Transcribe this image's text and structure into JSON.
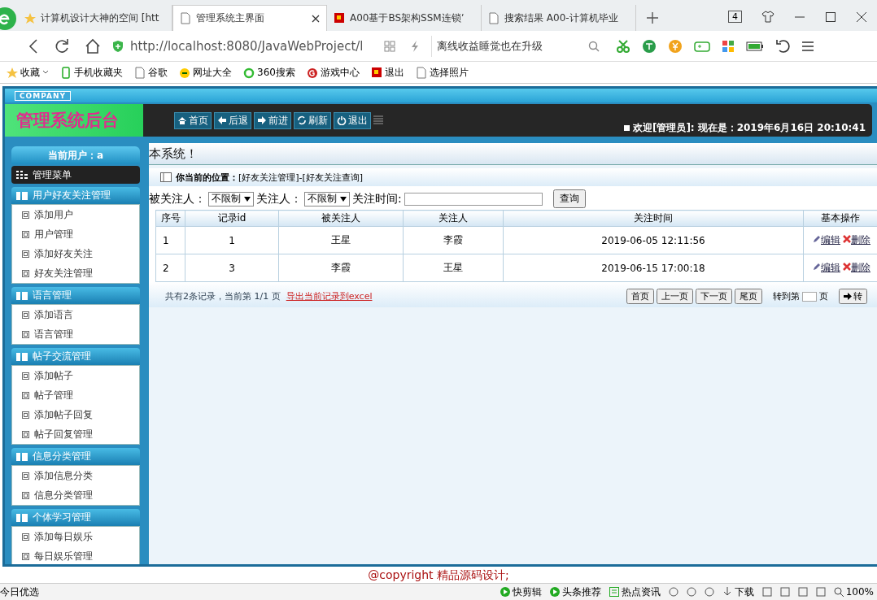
{
  "browser": {
    "tabs": [
      {
        "title": "计算机设计大神的空间 [htt",
        "selected": false,
        "kind": "star"
      },
      {
        "title": "管理系统主界面",
        "selected": true,
        "kind": "page"
      },
      {
        "title": "A00基于BS架构SSM连锁ʼ",
        "selected": false,
        "kind": "red"
      },
      {
        "title": "搜索结果 A00-计算机毕业",
        "selected": false,
        "kind": "page"
      }
    ],
    "tab_count": "4",
    "url": "http://localhost:8080/JavaWebProject/l",
    "search_text": "离线收益睡觉也在升级",
    "bookmarks": [
      "收藏",
      "手机收藏夹",
      "谷歌",
      "网址大全",
      "360搜索",
      "游戏中心",
      "退出",
      "选择照片"
    ]
  },
  "header": {
    "company": "COMPANY",
    "title": "管理系统后台",
    "nav_buttons": [
      "首页",
      "后退",
      "前进",
      "刷新",
      "退出"
    ],
    "welcome": "欢迎[管理员]:",
    "clock": "现在是：2019年6月16日 20:10:41"
  },
  "sidebar": {
    "current_user": "当前用户：a",
    "menu_title": "管理菜单",
    "groups": [
      {
        "title": "用户好友关注管理",
        "items": [
          "添加用户",
          "用户管理",
          "添加好友关注",
          "好友关注管理"
        ]
      },
      {
        "title": "语言管理",
        "items": [
          "添加语言",
          "语言管理"
        ]
      },
      {
        "title": "帖子交流管理",
        "items": [
          "添加帖子",
          "帖子管理",
          "添加帖子回复",
          "帖子回复管理"
        ]
      },
      {
        "title": "信息分类管理",
        "items": [
          "添加信息分类",
          "信息分类管理"
        ]
      },
      {
        "title": "个体学习管理",
        "items": [
          "添加每日娱乐",
          "每日娱乐管理"
        ]
      }
    ]
  },
  "marquee": "本系统！",
  "location": {
    "label": "你当前的位置：",
    "path": "[好友关注管理]-[好友关注查询]"
  },
  "filters": {
    "followed_label": "被关注人：",
    "followed_value": "不限制",
    "follower_label": "关注人：",
    "follower_value": "不限制",
    "time_label": "关注时间:",
    "query_button": "查询"
  },
  "table": {
    "columns": [
      "序号",
      "记录id",
      "被关注人",
      "关注人",
      "关注时间",
      "基本操作"
    ],
    "rows": [
      {
        "cells": [
          "1",
          "1",
          "王星",
          "李霞",
          "2019-06-05 12:11:56"
        ],
        "edit": "编辑",
        "delete": "删除"
      },
      {
        "cells": [
          "2",
          "3",
          "李霞",
          "王星",
          "2019-06-15 17:00:18"
        ],
        "edit": "编辑",
        "delete": "删除"
      }
    ]
  },
  "pager": {
    "summary": "共有2条记录，当前第 1/1 页",
    "export_link": "导出当前记录到excel",
    "buttons": [
      "首页",
      "上一页",
      "下一页",
      "尾页"
    ],
    "goto_label": "转到第",
    "page_label": "页",
    "go_button": "转"
  },
  "copyright": "@copyright 精品源码设计;",
  "status_bar": {
    "left": "今日优选",
    "items": [
      "快剪辑",
      "头条推荐",
      "热点资讯",
      "下载",
      "100%"
    ]
  }
}
